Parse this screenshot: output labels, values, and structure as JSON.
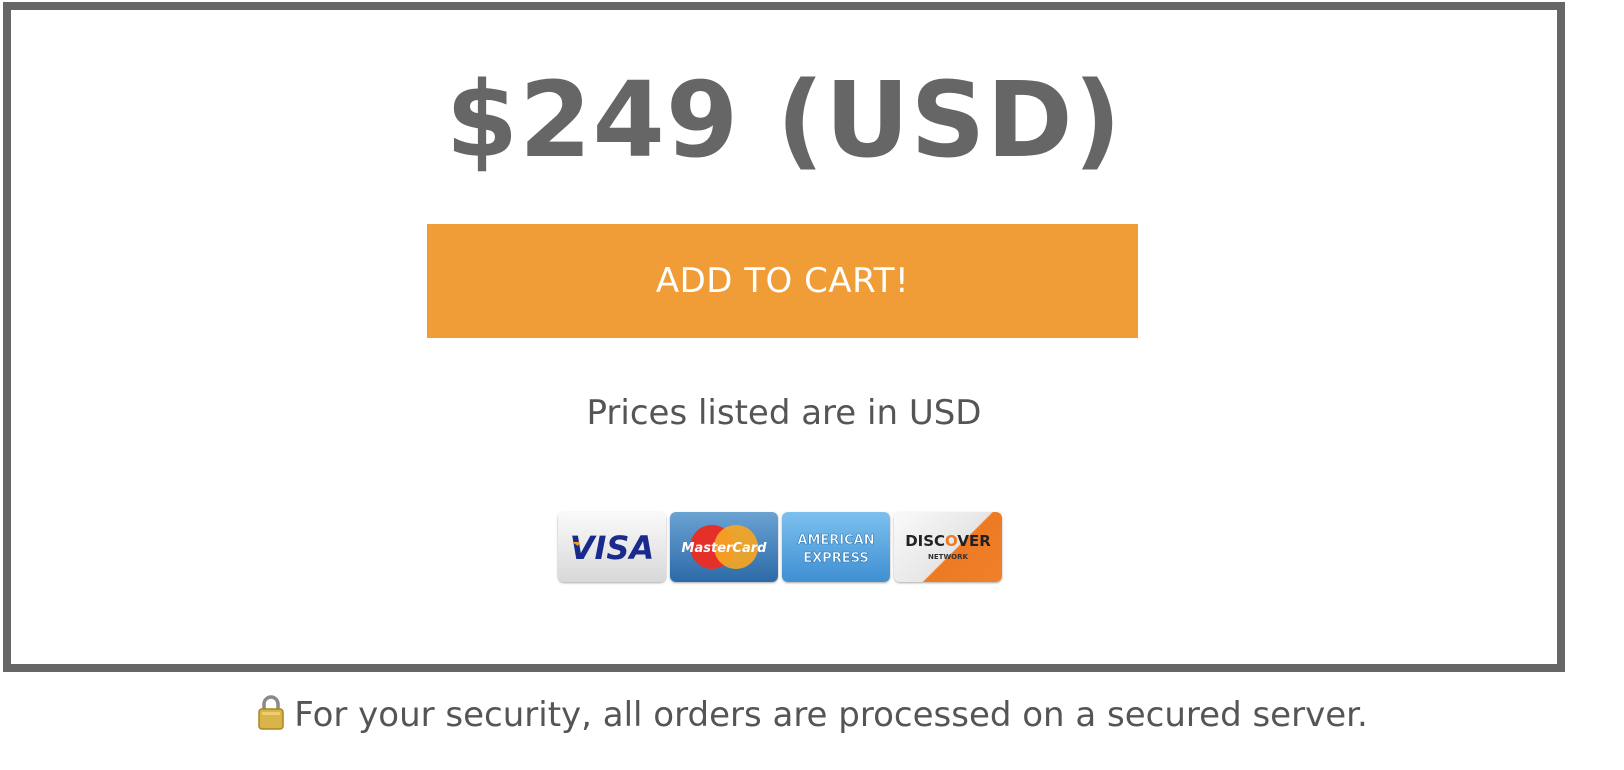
{
  "pricing": {
    "price": "$249 (USD)",
    "cart_button_label": "ADD TO CART!",
    "currency_note": "Prices listed are in USD"
  },
  "payment_methods": [
    {
      "name": "VISA"
    },
    {
      "name": "MasterCard"
    },
    {
      "name": "AMERICAN EXPRESS"
    },
    {
      "name": "DISCOVER NETWORK"
    }
  ],
  "security_note": "For your security, all orders are processed on a secured server.",
  "colors": {
    "button": "#f09c37",
    "border": "#666666",
    "text": "#555555"
  }
}
